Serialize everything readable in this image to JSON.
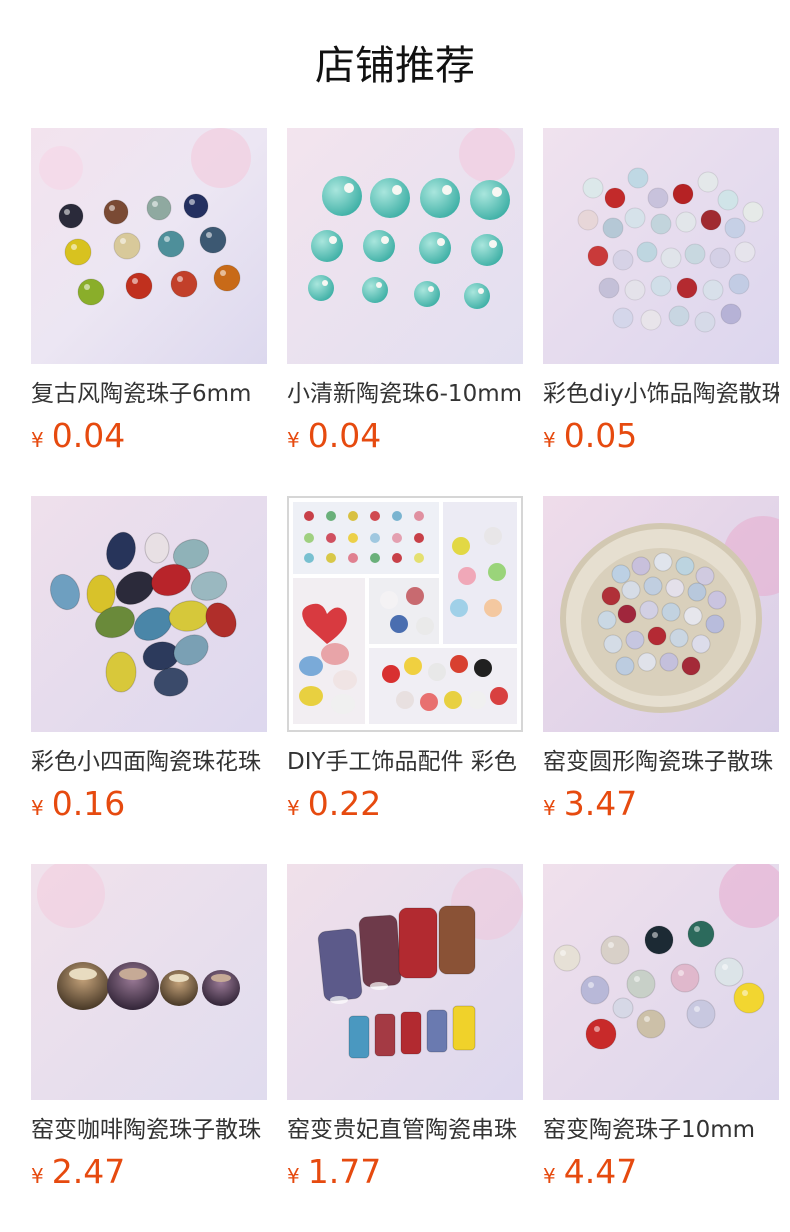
{
  "header": {
    "title": "店铺推荐"
  },
  "currency": "¥",
  "products": [
    {
      "name": "复古风陶瓷珠子6mm",
      "price": "0.04",
      "image_icon": "beads-retro-mix-photo"
    },
    {
      "name": "小清新陶瓷珠6-10mm",
      "price": "0.04",
      "image_icon": "beads-turquoise-photo"
    },
    {
      "name": "彩色diy小饰品陶瓷散珠",
      "price": "0.05",
      "image_icon": "beads-pastel-pile-photo"
    },
    {
      "name": "彩色小四面陶瓷珠花珠",
      "price": "0.16",
      "image_icon": "beads-oval-faceted-photo"
    },
    {
      "name": "DIY手工饰品配件 彩色",
      "price": "0.22",
      "image_icon": "beads-collage-photo"
    },
    {
      "name": "窑变圆形陶瓷珠子散珠",
      "price": "3.47",
      "image_icon": "beads-in-nest-photo"
    },
    {
      "name": "窑变咖啡陶瓷珠子散珠",
      "price": "2.47",
      "image_icon": "beads-coffee-row-photo"
    },
    {
      "name": "窑变贵妃直管陶瓷串珠",
      "price": "1.77",
      "image_icon": "beads-tube-photo"
    },
    {
      "name": "窑变陶瓷珠子10mm",
      "price": "4.47",
      "image_icon": "beads-glazed-mix-photo"
    }
  ]
}
